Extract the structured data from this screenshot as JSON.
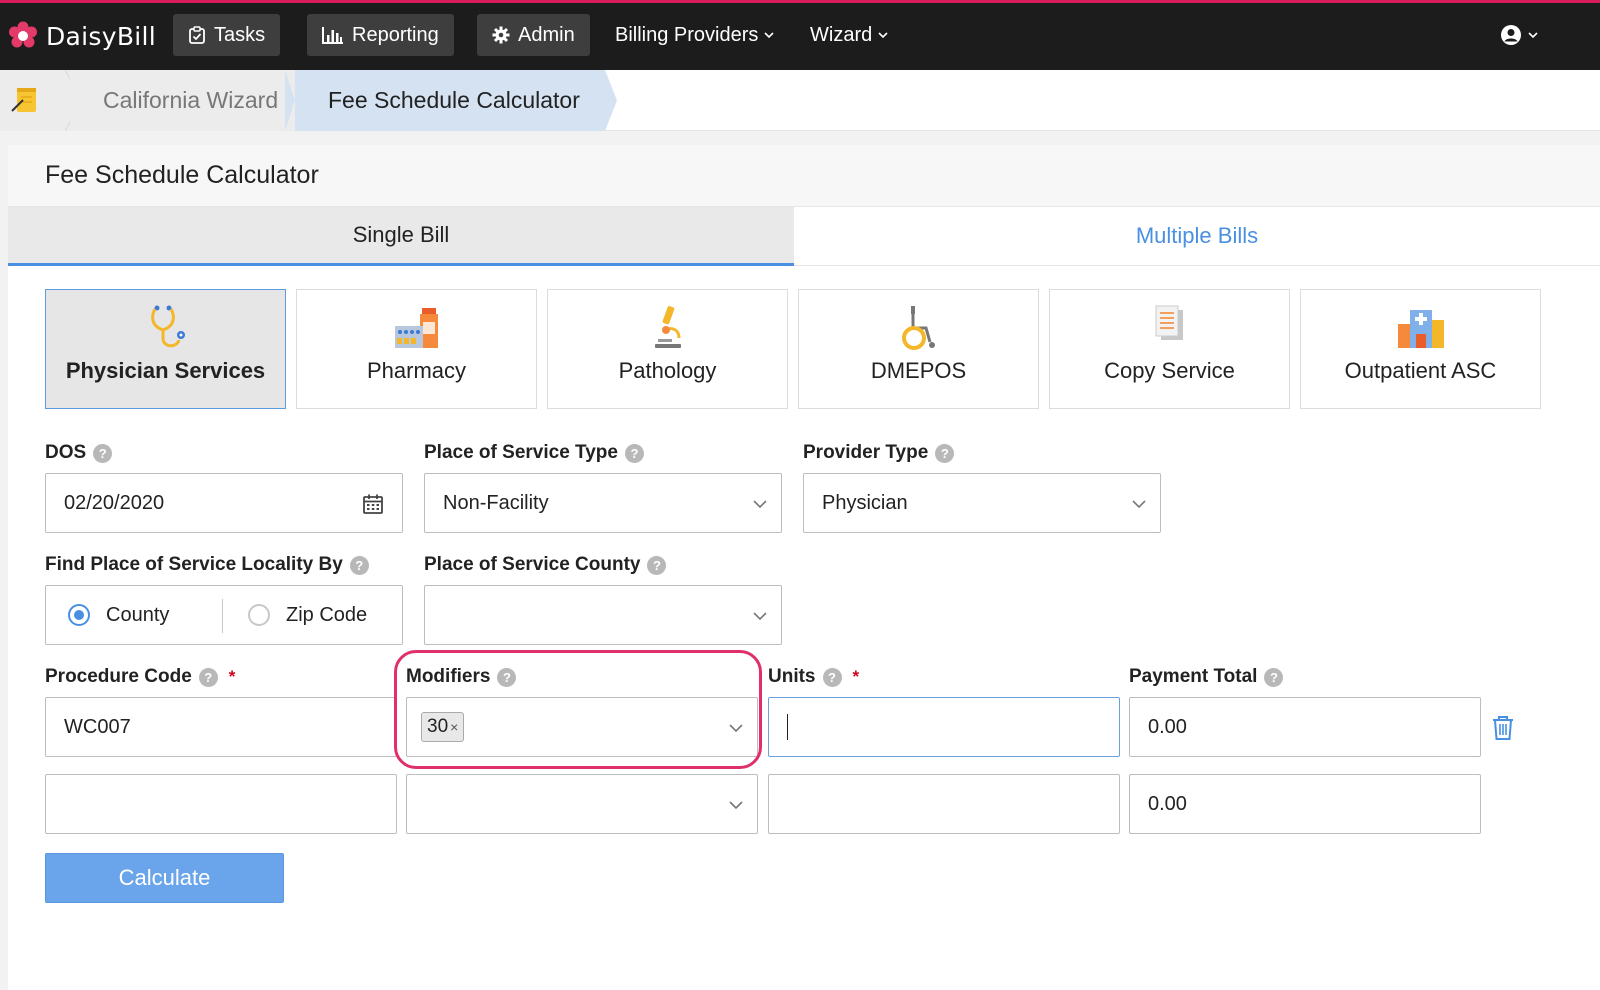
{
  "nav": {
    "brand": "DaisyBill",
    "tasks": "Tasks",
    "reporting": "Reporting",
    "admin": "Admin",
    "billing_providers": "Billing Providers",
    "wizard": "Wizard"
  },
  "breadcrumb": {
    "items": [
      "California Wizard",
      "Fee Schedule Calculator"
    ]
  },
  "page": {
    "title": "Fee Schedule Calculator"
  },
  "tabs": [
    {
      "label": "Single Bill",
      "active": true
    },
    {
      "label": "Multiple Bills",
      "active": false
    }
  ],
  "service_types": [
    {
      "label": "Physician Services",
      "icon": "stethoscope-icon",
      "active": true
    },
    {
      "label": "Pharmacy",
      "icon": "pill-bottle-icon",
      "active": false
    },
    {
      "label": "Pathology",
      "icon": "microscope-icon",
      "active": false
    },
    {
      "label": "DMEPOS",
      "icon": "wheelchair-icon",
      "active": false
    },
    {
      "label": "Copy Service",
      "icon": "document-copy-icon",
      "active": false
    },
    {
      "label": "Outpatient ASC",
      "icon": "hospital-icon",
      "active": false
    }
  ],
  "form": {
    "dos": {
      "label": "DOS",
      "value": "02/20/2020"
    },
    "pos_type": {
      "label": "Place of Service Type",
      "value": "Non-Facility"
    },
    "provider_type": {
      "label": "Provider Type",
      "value": "Physician"
    },
    "locality_by": {
      "label": "Find Place of Service Locality By",
      "options": [
        "County",
        "Zip Code"
      ],
      "selected": "County"
    },
    "pos_county": {
      "label": "Place of Service County",
      "value": ""
    },
    "procedure_code": {
      "label": "Procedure Code"
    },
    "modifiers": {
      "label": "Modifiers"
    },
    "units": {
      "label": "Units"
    },
    "payment_total": {
      "label": "Payment Total"
    },
    "required_mark": "*",
    "rows": [
      {
        "procedure_code": "WC007",
        "modifiers": [
          "30"
        ],
        "units": "",
        "payment_total": "0.00"
      },
      {
        "procedure_code": "",
        "modifiers": [],
        "units": "",
        "payment_total": "0.00"
      }
    ]
  },
  "help_glyph": "?",
  "chip_remove_glyph": "×",
  "calculate_label": "Calculate",
  "colors": {
    "accent": "#4a90e2",
    "brand_pink": "#d81b5a",
    "highlight": "#e0306c",
    "button": "#6aa4ea"
  }
}
